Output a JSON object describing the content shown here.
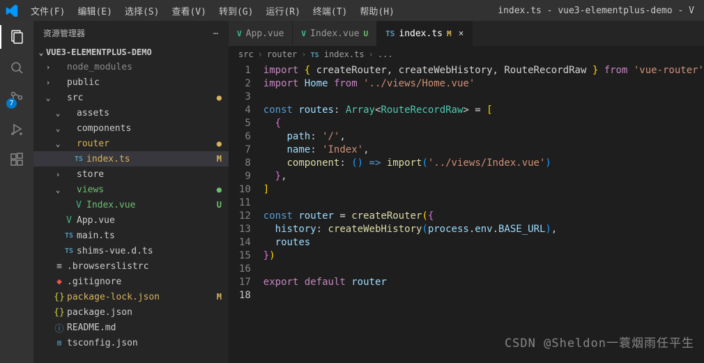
{
  "title": "index.ts - vue3-elementplus-demo - V",
  "menu": [
    "文件(F)",
    "编辑(E)",
    "选择(S)",
    "查看(V)",
    "转到(G)",
    "运行(R)",
    "终端(T)",
    "帮助(H)"
  ],
  "activity": {
    "badge": "7"
  },
  "sidebar": {
    "title": "资源管理器",
    "root": "VUE3-ELEMENTPLUS-DEMO",
    "items": [
      {
        "indent": 1,
        "chev": "›",
        "icon": "",
        "label": "node_modules",
        "cls": "dim"
      },
      {
        "indent": 1,
        "chev": "›",
        "icon": "",
        "label": "public"
      },
      {
        "indent": 1,
        "chev": "⌄",
        "icon": "",
        "label": "src",
        "mark": "●",
        "mcls": "dot-m"
      },
      {
        "indent": 2,
        "chev": "⌄",
        "icon": "",
        "label": "assets"
      },
      {
        "indent": 2,
        "chev": "⌄",
        "icon": "",
        "label": "components"
      },
      {
        "indent": 2,
        "chev": "⌄",
        "icon": "",
        "label": "router",
        "mark": "●",
        "mcls": "dot-m",
        "cls": "mod"
      },
      {
        "indent": 3,
        "chev": "",
        "icon": "TS",
        "iconcls": "ic-ts",
        "label": "index.ts",
        "mark": "M",
        "mcls": "mod",
        "cls": "mod",
        "sel": true
      },
      {
        "indent": 2,
        "chev": "›",
        "icon": "",
        "label": "store"
      },
      {
        "indent": 2,
        "chev": "⌄",
        "icon": "",
        "label": "views",
        "mark": "●",
        "mcls": "dot-u",
        "cls": "unt"
      },
      {
        "indent": 3,
        "chev": "",
        "icon": "V",
        "iconcls": "ic-vue",
        "label": "Index.vue",
        "mark": "U",
        "mcls": "unt",
        "cls": "unt"
      },
      {
        "indent": 2,
        "chev": "",
        "icon": "V",
        "iconcls": "ic-vue",
        "label": "App.vue"
      },
      {
        "indent": 2,
        "chev": "",
        "icon": "TS",
        "iconcls": "ic-ts",
        "label": "main.ts"
      },
      {
        "indent": 2,
        "chev": "",
        "icon": "TS",
        "iconcls": "ic-ts",
        "label": "shims-vue.d.ts"
      },
      {
        "indent": 1,
        "chev": "",
        "icon": "≡",
        "iconcls": "ic-conf",
        "label": ".browserslistrc"
      },
      {
        "indent": 1,
        "chev": "",
        "icon": "◆",
        "iconcls": "ic-git",
        "label": ".gitignore"
      },
      {
        "indent": 1,
        "chev": "",
        "icon": "{}",
        "iconcls": "ic-js",
        "label": "package-lock.json",
        "mark": "M",
        "mcls": "mod",
        "cls": "mod"
      },
      {
        "indent": 1,
        "chev": "",
        "icon": "{}",
        "iconcls": "ic-js",
        "label": "package.json"
      },
      {
        "indent": 1,
        "chev": "",
        "icon": "ⓘ",
        "iconcls": "ic-md",
        "label": "README.md"
      },
      {
        "indent": 1,
        "chev": "",
        "icon": "▤",
        "iconcls": "ic-ts",
        "label": "tsconfig.json"
      }
    ]
  },
  "tabs": [
    {
      "icon": "V",
      "iconcls": "ic-vue",
      "label": "App.vue",
      "mark": "",
      "mcls": ""
    },
    {
      "icon": "V",
      "iconcls": "ic-vue",
      "label": "Index.vue",
      "mark": "U",
      "mcls": "unt"
    },
    {
      "icon": "TS",
      "iconcls": "ic-ts",
      "label": "index.ts",
      "mark": "M",
      "mcls": "mod",
      "active": true,
      "close": true
    }
  ],
  "breadcrumb": [
    "src",
    "router",
    "index.ts",
    "..."
  ],
  "code": {
    "lines": 18,
    "current": 18,
    "content": [
      [
        [
          "import",
          "tok-kw"
        ],
        [
          " ",
          ""
        ],
        [
          "{",
          "tok-brace"
        ],
        [
          " createRouter",
          ""
        ],
        [
          ",",
          ""
        ],
        [
          " createWebHistory",
          ""
        ],
        [
          ",",
          ""
        ],
        [
          " RouteRecordRaw ",
          ""
        ],
        [
          "}",
          "tok-brace"
        ],
        [
          " ",
          ""
        ],
        [
          "from",
          "tok-kw"
        ],
        [
          " ",
          ""
        ],
        [
          "'vue-router'",
          "tok-str"
        ]
      ],
      [
        [
          "import",
          "tok-kw"
        ],
        [
          " ",
          ""
        ],
        [
          "Home",
          "tok-var"
        ],
        [
          " ",
          ""
        ],
        [
          "from",
          "tok-kw"
        ],
        [
          " ",
          ""
        ],
        [
          "'../views/Home.vue'",
          "tok-str"
        ]
      ],
      [],
      [
        [
          "const",
          "tok-const"
        ],
        [
          " ",
          ""
        ],
        [
          "routes",
          "tok-var"
        ],
        [
          ": ",
          ""
        ],
        [
          "Array",
          "tok-type"
        ],
        [
          "<",
          ""
        ],
        [
          "RouteRecordRaw",
          "tok-type"
        ],
        [
          "> = ",
          ""
        ],
        [
          "[",
          "tok-brace"
        ]
      ],
      [
        [
          "  ",
          ""
        ],
        [
          "{",
          "tok-brace2"
        ]
      ],
      [
        [
          "    ",
          ""
        ],
        [
          "path",
          "tok-prop"
        ],
        [
          ": ",
          ""
        ],
        [
          "'/'",
          "tok-str"
        ],
        [
          ",",
          ""
        ]
      ],
      [
        [
          "    ",
          ""
        ],
        [
          "name",
          "tok-prop"
        ],
        [
          ": ",
          ""
        ],
        [
          "'Index'",
          "tok-str"
        ],
        [
          ",",
          ""
        ]
      ],
      [
        [
          "    ",
          ""
        ],
        [
          "component",
          "tok-fn"
        ],
        [
          ": ",
          ""
        ],
        [
          "(",
          "tok-brace3"
        ],
        [
          ")",
          "tok-brace3"
        ],
        [
          " ",
          ""
        ],
        [
          "=>",
          "tok-const"
        ],
        [
          " ",
          ""
        ],
        [
          "import",
          "tok-fn"
        ],
        [
          "(",
          "tok-brace3"
        ],
        [
          "'../views/Index.vue'",
          "tok-str"
        ],
        [
          ")",
          "tok-brace3"
        ]
      ],
      [
        [
          "  ",
          ""
        ],
        [
          "}",
          "tok-brace2"
        ],
        [
          ",",
          ""
        ]
      ],
      [
        [
          "]",
          "tok-brace"
        ]
      ],
      [],
      [
        [
          "const",
          "tok-const"
        ],
        [
          " ",
          ""
        ],
        [
          "router",
          "tok-var"
        ],
        [
          " = ",
          ""
        ],
        [
          "createRouter",
          "tok-fn"
        ],
        [
          "(",
          "tok-brace"
        ],
        [
          "{",
          "tok-brace2"
        ]
      ],
      [
        [
          "  ",
          ""
        ],
        [
          "history",
          "tok-prop"
        ],
        [
          ": ",
          ""
        ],
        [
          "createWebHistory",
          "tok-fn"
        ],
        [
          "(",
          "tok-brace3"
        ],
        [
          "process",
          "tok-var"
        ],
        [
          ".",
          ""
        ],
        [
          "env",
          "tok-var"
        ],
        [
          ".",
          ""
        ],
        [
          "BASE_URL",
          "tok-var"
        ],
        [
          ")",
          "tok-brace3"
        ],
        [
          ",",
          ""
        ]
      ],
      [
        [
          "  ",
          ""
        ],
        [
          "routes",
          "tok-var"
        ]
      ],
      [
        [
          "}",
          "tok-brace2"
        ],
        [
          ")",
          "tok-brace"
        ]
      ],
      [],
      [
        [
          "export",
          "tok-kw"
        ],
        [
          " ",
          ""
        ],
        [
          "default",
          "tok-kw"
        ],
        [
          " ",
          ""
        ],
        [
          "router",
          "tok-var"
        ]
      ],
      []
    ]
  },
  "watermark": "CSDN @Sheldon一蓑烟雨任平生"
}
